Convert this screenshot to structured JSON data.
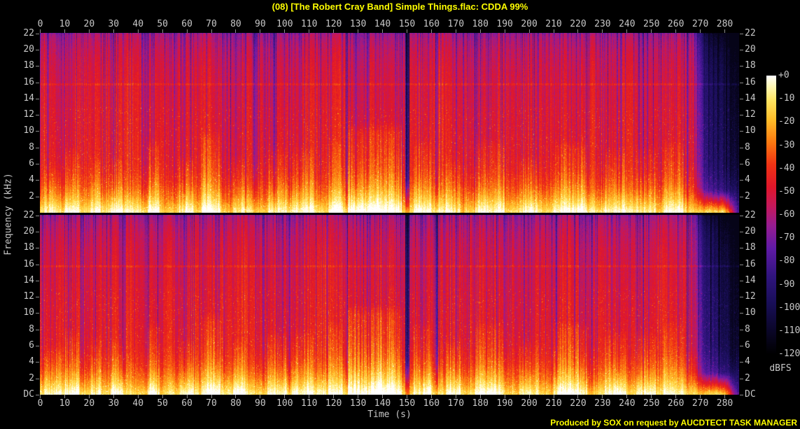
{
  "title": "(08) [The Robert Cray Band] Simple Things.flac: CDDA 99%",
  "credit": "Produced by SOX on request by AUCDTECT TASK MANAGER",
  "axes": {
    "time_label": "Time (s)",
    "freq_label": "Frequency (kHz)",
    "duration_s": 286,
    "freq_max_khz": 22.05,
    "time_ticks": [
      0,
      10,
      20,
      30,
      40,
      50,
      60,
      70,
      80,
      90,
      100,
      110,
      120,
      130,
      140,
      150,
      160,
      170,
      180,
      190,
      200,
      210,
      220,
      230,
      240,
      250,
      260,
      270,
      280
    ],
    "freq_ticks_top_panel": [
      "22",
      "20",
      "18",
      "16",
      "14",
      "12",
      "10",
      "8",
      "6",
      "4",
      "2"
    ],
    "freq_ticks_bottom_panel": [
      "22",
      "20",
      "18",
      "16",
      "14",
      "12",
      "10",
      "8",
      "6",
      "4",
      "2",
      "DC"
    ]
  },
  "colorbar": {
    "unit": "dBFS",
    "tick_labels": [
      "+0",
      "-10",
      "-20",
      "-30",
      "-40",
      "-50",
      "-60",
      "-70",
      "-80",
      "-90",
      "-100",
      "-110",
      "-120"
    ],
    "gradient_stops": [
      {
        "value": 1.0,
        "color": "#ffffff"
      },
      {
        "value": 0.96,
        "color": "#fff8b4"
      },
      {
        "value": 0.91,
        "color": "#ffe460"
      },
      {
        "value": 0.84,
        "color": "#ffbc28"
      },
      {
        "value": 0.76,
        "color": "#fc7810"
      },
      {
        "value": 0.68,
        "color": "#f03214"
      },
      {
        "value": 0.6,
        "color": "#e0162a"
      },
      {
        "value": 0.53,
        "color": "#c4185c"
      },
      {
        "value": 0.46,
        "color": "#961c92"
      },
      {
        "value": 0.38,
        "color": "#601aa6"
      },
      {
        "value": 0.28,
        "color": "#30147e"
      },
      {
        "value": 0.18,
        "color": "#180e56"
      },
      {
        "value": 0.08,
        "color": "#0a0626"
      },
      {
        "value": 0.0,
        "color": "#000000"
      }
    ]
  },
  "colors": {
    "background": "#000000",
    "title_text": "#ffff00",
    "axis_text": "#c8c8c8",
    "tick_mark": "#8a8a8a"
  },
  "chart_data": {
    "type": "heatmap",
    "subtype": "audio-spectrogram",
    "title": "(08) [The Robert Cray Band] Simple Things.flac: CDDA 99%",
    "xlabel": "Time (s)",
    "ylabel": "Frequency (kHz)",
    "x_range": [
      0,
      286
    ],
    "x_ticks": [
      0,
      10,
      20,
      30,
      40,
      50,
      60,
      70,
      80,
      90,
      100,
      110,
      120,
      130,
      140,
      150,
      160,
      170,
      180,
      190,
      200,
      210,
      220,
      230,
      240,
      250,
      260,
      270,
      280
    ],
    "y_range_khz": [
      0,
      22.05
    ],
    "y_tick_labels": [
      "22",
      "20",
      "18",
      "16",
      "14",
      "12",
      "10",
      "8",
      "6",
      "4",
      "2",
      "DC"
    ],
    "panels": [
      "channel-1-top",
      "channel-2-bottom"
    ],
    "colorbar": {
      "unit": "dBFS",
      "top_label": "+0",
      "bottom_label": "-120",
      "step_db": 10,
      "position": "right"
    },
    "grid": false,
    "legend_position": "right"
  },
  "spectrogram_render": {
    "seed": 42,
    "fade_start_s": 267,
    "bass_hold_until_s": 280,
    "hf_line_khz": 15.8,
    "bursts": [
      [
        2,
        9,
        5,
        0.1
      ],
      [
        10,
        16,
        7,
        0.13
      ],
      [
        21,
        25,
        6,
        0.12
      ],
      [
        29,
        34,
        6,
        0.1
      ],
      [
        44,
        49,
        8,
        0.14
      ],
      [
        57,
        63,
        6,
        0.1
      ],
      [
        66,
        74,
        9,
        0.17
      ],
      [
        79,
        84,
        6,
        0.1
      ],
      [
        93,
        101,
        7,
        0.12
      ],
      [
        103,
        112,
        7,
        0.12
      ],
      [
        118,
        124,
        8,
        0.12
      ],
      [
        126,
        137,
        10,
        0.19
      ],
      [
        137,
        148,
        10,
        0.21
      ],
      [
        153,
        160,
        8,
        0.13
      ],
      [
        166,
        172,
        6,
        0.1
      ],
      [
        178,
        190,
        8,
        0.13
      ],
      [
        196,
        204,
        6,
        0.1
      ],
      [
        210,
        224,
        8,
        0.15
      ],
      [
        231,
        240,
        7,
        0.12
      ],
      [
        244,
        252,
        7,
        0.12
      ],
      [
        255,
        263,
        8,
        0.13
      ]
    ],
    "gaps": [
      [
        149.3,
        151.3,
        0.3
      ],
      [
        161.8,
        162.9,
        0.18
      ],
      [
        58.8,
        59.6,
        0.12
      ],
      [
        125.2,
        125.9,
        0.12
      ],
      [
        246.5,
        247.2,
        0.12
      ],
      [
        264.6,
        265.4,
        0.14
      ],
      [
        33.8,
        34.4,
        0.1
      ],
      [
        101.5,
        102.1,
        0.1
      ]
    ]
  }
}
